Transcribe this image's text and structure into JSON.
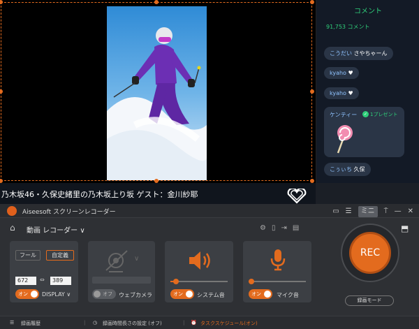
{
  "chat": {
    "title": "コメント",
    "count": "91,753 コメント",
    "messages": [
      {
        "user": "こうだい",
        "text": "さやちゃーん"
      },
      {
        "user": "kyaho",
        "text": "♥"
      },
      {
        "user": "kyaho",
        "text": "♥"
      },
      {
        "user": "こぅぃち",
        "text": "久保"
      }
    ],
    "gift": {
      "user": "ケンティー",
      "label": "1プレゼント"
    }
  },
  "video": {
    "caption": "乃木坂46・久保史緒里の乃木坂上り坂 ゲスト：金川紗耶"
  },
  "recorder": {
    "app_title": "Aiseesoft スクリーンレコーダー",
    "mini_label": "ミニ",
    "mode_label": "動画 レコーダー",
    "display_panel": {
      "full_label": "フール",
      "custom_label": "自定義",
      "width": "672",
      "height": "389",
      "toggle_label": "オン",
      "display_label": "DISPLAY"
    },
    "webcam_panel": {
      "toggle_label": "オフ",
      "label": "ウェブカメラ"
    },
    "system_panel": {
      "toggle_label": "オン",
      "label": "システム音",
      "volume": 0.1
    },
    "mic_panel": {
      "toggle_label": "オン",
      "label": "マイク音",
      "volume": 0.05
    },
    "rec_label": "REC",
    "rec_mode_label": "録画モード",
    "status": {
      "history": "録画履歴",
      "duration": "録画時間長さの設定 (オフ)",
      "schedule": "タスクスケジュール(オン)"
    },
    "colors": {
      "accent": "#e36b1e"
    }
  }
}
